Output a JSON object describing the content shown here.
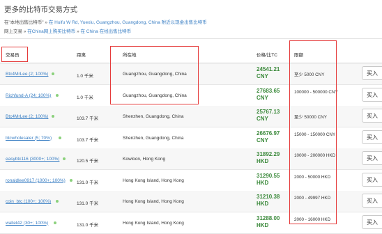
{
  "header": {
    "title": "更多的比特币交易方式",
    "line1_prefix": "在\"本地出售比特币\" »",
    "line1_link": "在 Huifu W Rd, Yuexiu, Guangzhou, Guangdong, China 附近以现金出售比特币",
    "line2_prefix": "网上交易 »",
    "line2_link1": "在China网上购买比特币",
    "line2_mid": "»",
    "line2_link2": "在 China 在线出售比特币"
  },
  "table": {
    "headers": {
      "trader": "交易员",
      "distance": "距离",
      "location": "所在地",
      "price": "价格/比TC",
      "limits": "限额",
      "action": ""
    },
    "rows": [
      {
        "trader": "Btc4MrLee (2; 100%)",
        "distance": "1.0 千米",
        "location": "Guangzhou, Guangdong, China",
        "price": "24541.21 CNY",
        "limits": "至少 5000 CNY",
        "buy": "买入"
      },
      {
        "trader": "Richfund-A (24; 100%)",
        "distance": "1.0 千米",
        "location": "Guangzhou, Guangdong, China",
        "price": "27683.65 CNY",
        "limits": "100000 - 500000 CNY",
        "buy": "买入"
      },
      {
        "trader": "Btc4MrLee (2; 100%)",
        "distance": "103.7 千米",
        "location": "Shenzhen, Guangdong, China",
        "price": "25767.13 CNY",
        "limits": "至少 50000 CNY",
        "buy": "买入"
      },
      {
        "trader": "btcwholesaler (5; 70%)",
        "distance": "103.7 千米",
        "location": "Shenzhen, Guangdong, China",
        "price": "26676.97 CNY",
        "limits": "15000 - 150000 CNY",
        "buy": "买入"
      },
      {
        "trader": "easybtc116 (3000+; 100%)",
        "distance": "120.5 千米",
        "location": "Kowloon, Hong Kong",
        "price": "31892.29 HKD",
        "limits": "10000 - 200000 HKD",
        "buy": "买入"
      },
      {
        "trader": "ronaldlee0917 (1000+; 100%)",
        "distance": "131.0 千米",
        "location": "Hong Kong Island, Hong Kong",
        "price": "31290.55 HKD",
        "limits": "2000 - 50000 HKD",
        "buy": "买入"
      },
      {
        "trader": "coin_btc (100+; 100%)",
        "distance": "131.0 千米",
        "location": "Hong Kong Island, Hong Kong",
        "price": "31210.38 HKD",
        "limits": "2000 - 49997 HKD",
        "buy": "买入"
      },
      {
        "trader": "wallet42 (30+; 100%)",
        "distance": "131.0 千米",
        "location": "Hong Kong Island, Hong Kong",
        "price": "31288.00 HKD",
        "limits": "2000 - 16000 HKD",
        "buy": "买入"
      }
    ]
  },
  "colors": {
    "highlight_box": "#e53a3a",
    "price_green": "#3c8a3c",
    "link_blue": "#3a7fc4",
    "online_dot": "#8bd17c"
  }
}
